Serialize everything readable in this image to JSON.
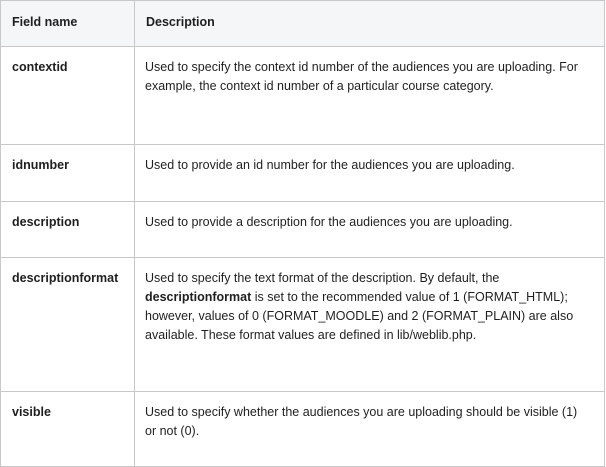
{
  "table": {
    "headers": {
      "field_name": "Field name",
      "description": "Description"
    },
    "rows": [
      {
        "field": "contextid",
        "description": [
          {
            "text": " Used to specify the context id number of the audiences you are uploading. For example, the context id number of a particular course category.",
            "bold": false
          }
        ]
      },
      {
        "field": "idnumber",
        "description": [
          {
            "text": "Used to provide an id number for the audiences you are uploading.",
            "bold": false
          }
        ]
      },
      {
        "field": "description",
        "description": [
          {
            "text": "Used to provide a description for the audiences you are uploading.",
            "bold": false
          }
        ]
      },
      {
        "field": "descriptionformat",
        "description": [
          {
            "text": "Used to specify the text format of the description. By default, the ",
            "bold": false
          },
          {
            "text": "descriptionformat",
            "bold": true
          },
          {
            "text": " is set to the recommended value of 1 (FORMAT_HTML); however, values of 0 (FORMAT_MOODLE) and 2 (FORMAT_PLAIN) are also available. These format values are defined in lib/weblib.php.",
            "bold": false
          }
        ]
      },
      {
        "field": "visible",
        "description": [
          {
            "text": "Used to specify whether the audiences you are uploading should be visible (1) or not (0).",
            "bold": false
          }
        ]
      }
    ]
  }
}
